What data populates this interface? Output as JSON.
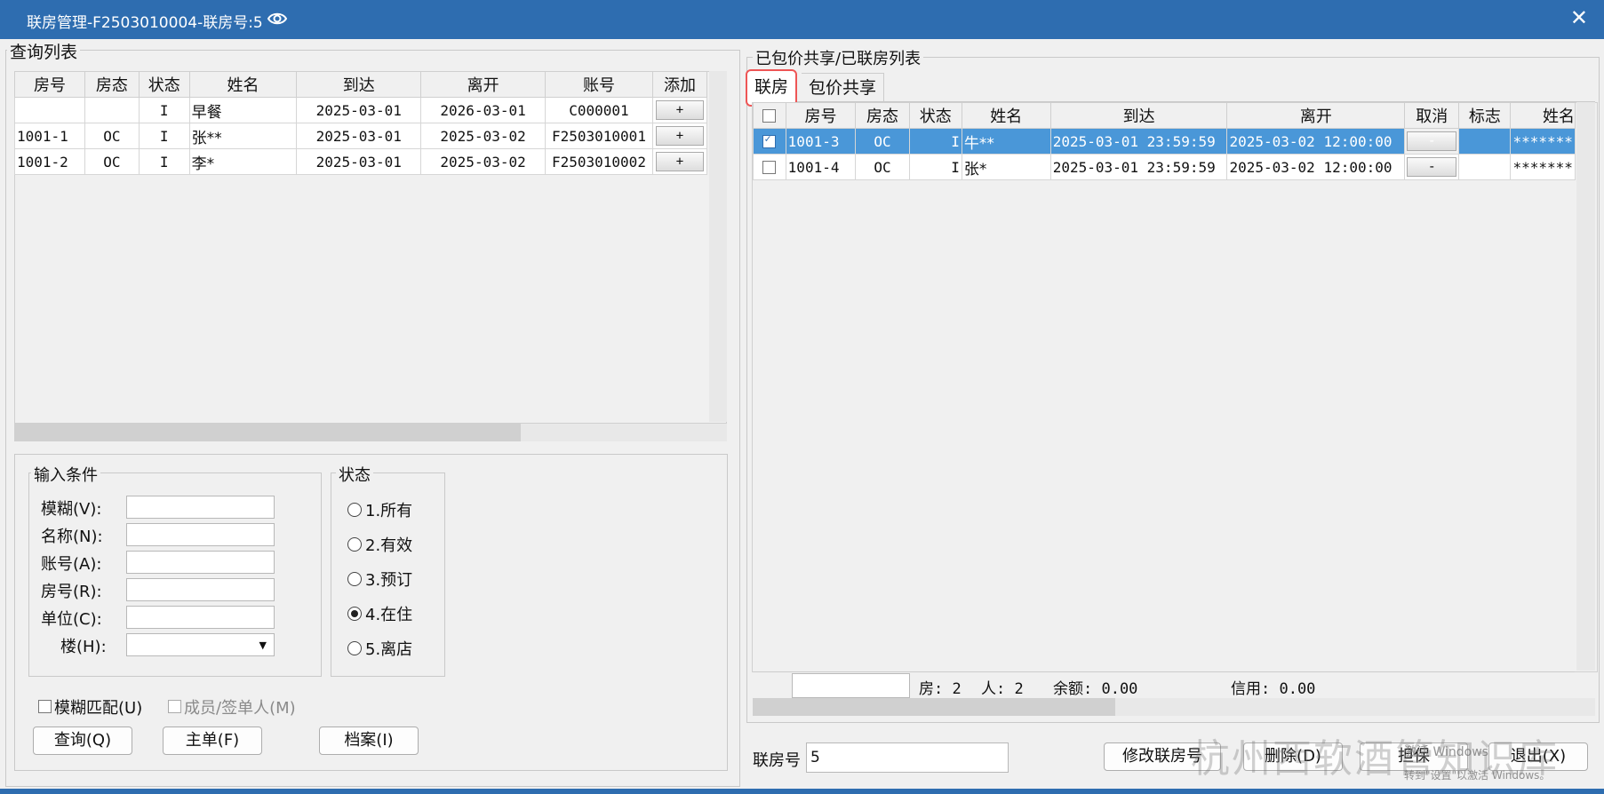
{
  "window": {
    "title": "联房管理-F2503010004-联房号:5"
  },
  "query": {
    "group_label": "查询列表",
    "columns": [
      "房号",
      "房态",
      "状态",
      "姓名",
      "到达",
      "离开",
      "账号",
      "添加"
    ],
    "rows": [
      {
        "room": "",
        "rstate": "",
        "status": "I",
        "name": "早餐",
        "arrive": "2025-03-01",
        "depart": "2026-03-01",
        "account": "C000001",
        "add": "+"
      },
      {
        "room": "1001-1",
        "rstate": "OC",
        "status": "I",
        "name": "张**",
        "arrive": "2025-03-01",
        "depart": "2025-03-02",
        "account": "F2503010001",
        "add": "+"
      },
      {
        "room": "1001-2",
        "rstate": "OC",
        "status": "I",
        "name": "李*",
        "arrive": "2025-03-01",
        "depart": "2025-03-02",
        "account": "F2503010002",
        "add": "+"
      }
    ]
  },
  "filters": {
    "input_group_label": "输入条件",
    "fuzzy": "模糊(V):",
    "name": "名称(N):",
    "account": "账号(A):",
    "room": "房号(R):",
    "unit": "单位(C):",
    "floor": "楼(H):",
    "status_group_label": "状态",
    "status_options": [
      "1.所有",
      "2.有效",
      "3.预订",
      "4.在住",
      "5.离店"
    ],
    "selected_status": "4.在住",
    "fuzzy_match": "模糊匹配(U)",
    "member": "成员/签单人(M)"
  },
  "buttons": {
    "query": "查询(Q)",
    "master": "主单(F)",
    "archive": "档案(I)",
    "modify": "修改联房号",
    "delete": "删除(D)",
    "guarantee": "担保",
    "exit": "退出(X)"
  },
  "linked": {
    "group_label": "已包价共享/已联房列表",
    "tabs": [
      "联房",
      "包价共享"
    ],
    "active_tab": "联房",
    "columns": [
      "房号",
      "房态",
      "状态",
      "姓名",
      "到达",
      "离开",
      "取消",
      "标志",
      "姓名"
    ],
    "rows": [
      {
        "checked": true,
        "room": "1001-3",
        "rstate": "OC",
        "status": "I",
        "name": "牛**",
        "arrive": "2025-03-01 23:59:59",
        "depart": "2025-03-02 12:00:00",
        "cancel": "-",
        "flag": "",
        "name2": "*******"
      },
      {
        "checked": false,
        "room": "1001-4",
        "rstate": "OC",
        "status": "I",
        "name": "张*",
        "arrive": "2025-03-01 23:59:59",
        "depart": "2025-03-02 12:00:00",
        "cancel": "-",
        "flag": "",
        "name2": "*******"
      }
    ],
    "summary": {
      "rooms": "房: 2",
      "people": "人: 2",
      "balance": "余额: 0.00",
      "credit": "信用: 0.00"
    }
  },
  "bottom": {
    "linked_no_label": "联房号",
    "linked_no_value": "5"
  },
  "overlay": {
    "watermark": "杭州西软酒管知识库",
    "win_line1": "激活 Windows",
    "win_line2": "转到\"设置\"以激活 Windows。"
  }
}
